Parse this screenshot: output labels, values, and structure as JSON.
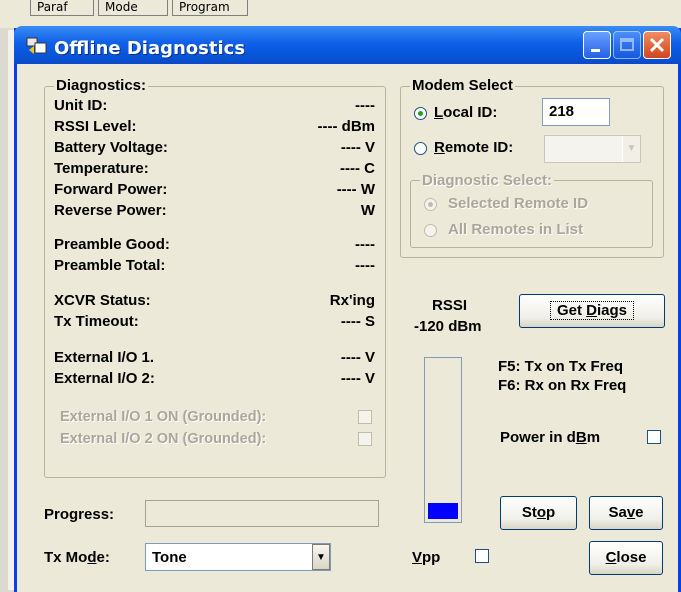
{
  "background_menu": {
    "tabs": [
      "Paraf",
      "Mode",
      "Program"
    ]
  },
  "window": {
    "title": "Offline Diagnostics"
  },
  "diagnostics": {
    "title": "Diagnostics:",
    "rows": [
      {
        "label": "Unit ID:",
        "value": "----"
      },
      {
        "label": "RSSI Level:",
        "value": "---- dBm"
      },
      {
        "label": "Battery Voltage:",
        "value": "---- V"
      },
      {
        "label": "Temperature:",
        "value": "---- C"
      },
      {
        "label": "Forward Power:",
        "value": "---- W"
      },
      {
        "label": "Reverse Power:",
        "value": "W"
      },
      {
        "label": "Preamble Good:",
        "value": "----"
      },
      {
        "label": "Preamble Total:",
        "value": "----"
      },
      {
        "label": "XCVR Status:",
        "value": "Rx'ing"
      },
      {
        "label": "Tx Timeout:",
        "value": "---- S"
      },
      {
        "label": "External I/O 1.",
        "value": "---- V"
      },
      {
        "label": "External I/O 2:",
        "value": "---- V"
      }
    ],
    "ext1_on_label": "External I/O 1 ON (Grounded):",
    "ext2_on_label": "External I/O 2 ON (Grounded):"
  },
  "modem_select": {
    "title": "Modem Select",
    "local_id_label": "Local ID:",
    "local_id_value": "218",
    "remote_id_label": "Remote ID:",
    "remote_id_value": "",
    "diagnostic_select": {
      "title": "Diagnostic Select:",
      "options": [
        "Selected Remote ID",
        "All Remotes in List"
      ]
    }
  },
  "rssi": {
    "title": "RSSI",
    "value": "-120 dBm",
    "bar_fill_percent": 10,
    "bar_color": "#0000ff"
  },
  "buttons": {
    "get_diags": "Get Diags",
    "stop": "Stop",
    "save": "Save",
    "close": "Close"
  },
  "hints": {
    "f5": "F5: Tx on Tx Freq",
    "f6": "F6: Rx on Rx Freq"
  },
  "power_in_dbm_label": "Power in dBm",
  "progress": {
    "label": "Progress:",
    "percent": 0
  },
  "tx_mode": {
    "label": "Tx Mode:",
    "value": "Tone"
  },
  "vpp_label": "Vpp",
  "colors": {
    "title_bar": "#0754d7",
    "window_face": "#ece9d8",
    "close_button": "#d2441c"
  }
}
